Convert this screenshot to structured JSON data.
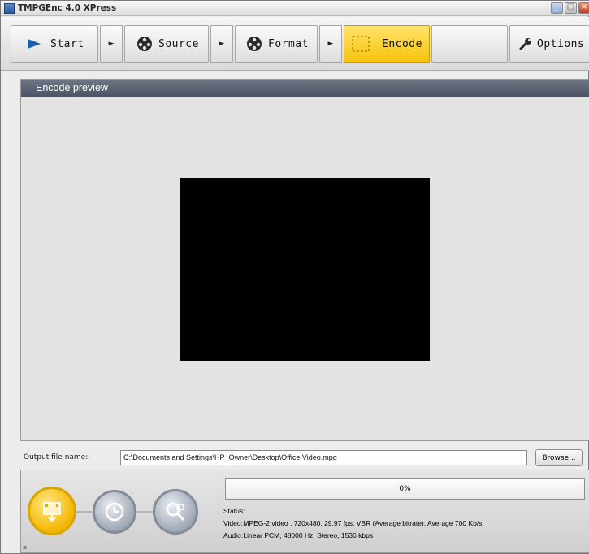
{
  "window": {
    "title": "TMPGEnc 4.0 XPress"
  },
  "toolbar": {
    "start_label": "Start",
    "source_label": "Source",
    "format_label": "Format",
    "encode_label": "Encode",
    "options_label": "Options",
    "arrow_glyph": "►",
    "active_color": "#f6c40c"
  },
  "preview": {
    "title": "Encode preview"
  },
  "output": {
    "label": "Output file name:",
    "path": "C:\\Documents and Settings\\HP_Owner\\Desktop\\Office Video.mpg",
    "browse_label": "Browse..."
  },
  "progress": {
    "text": "0%",
    "value": 0
  },
  "status": {
    "status_label": "Status:",
    "video_label": "Video:",
    "video_value": "MPEG-2 video , 720x480, 29.97 fps, VBR (Average bitrate), Average 700 Kb/s",
    "audio_label": "Audio:",
    "audio_value": "Linear PCM, 48000 Hz, Stereo, 1536 kbps"
  }
}
